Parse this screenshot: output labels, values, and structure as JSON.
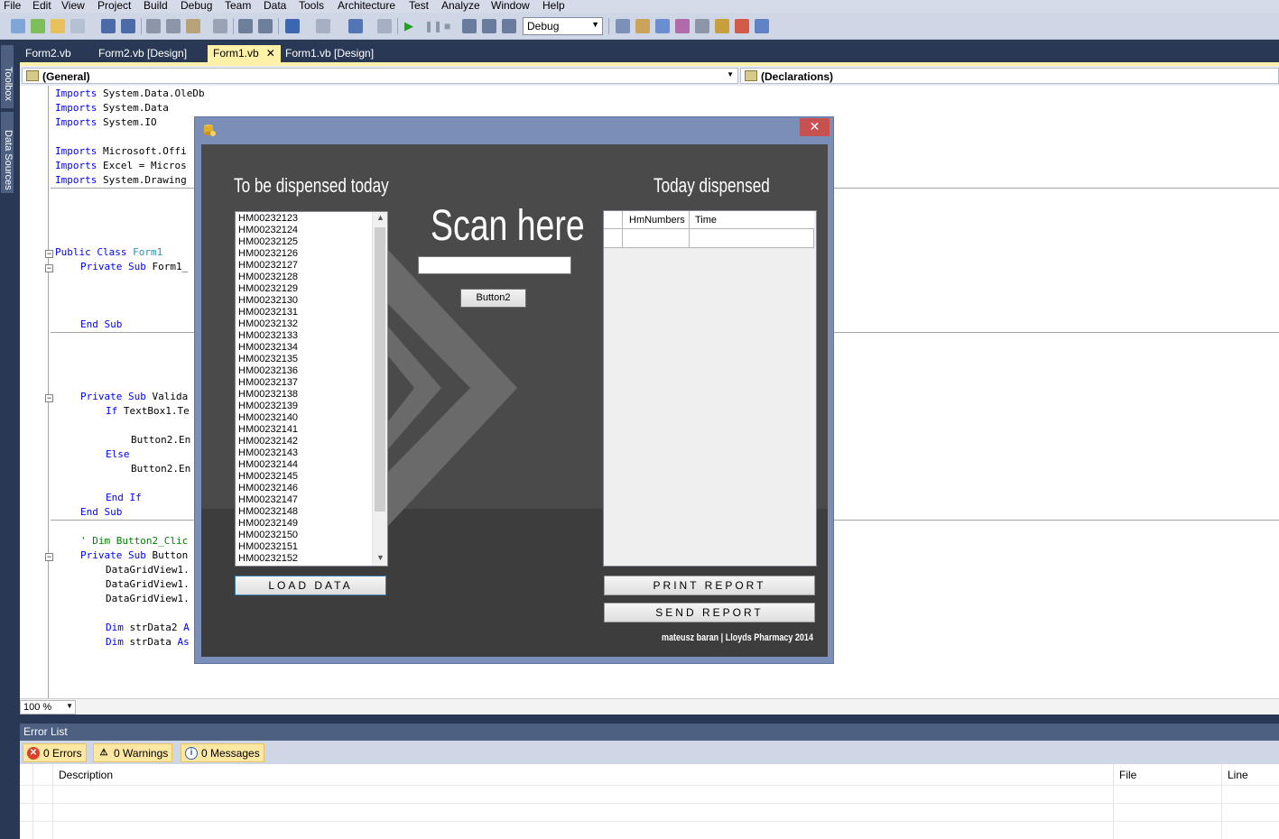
{
  "menu": [
    "File",
    "Edit",
    "View",
    "Project",
    "Build",
    "Debug",
    "Team",
    "Data",
    "Tools",
    "Architecture",
    "Test",
    "Analyze",
    "Window",
    "Help"
  ],
  "toolbar": {
    "configuration": "Debug"
  },
  "side_tabs": {
    "toolbox": "Toolbox",
    "data_sources": "Data Sources"
  },
  "doc_tabs": [
    "Form2.vb",
    "Form2.vb [Design]",
    "Form1.vb",
    "Form1.vb [Design]"
  ],
  "active_tab_close": "✕",
  "nav": {
    "left": "(General)",
    "right": "(Declarations)"
  },
  "code": {
    "l1": "Imports",
    "l1b": " System.Data.OleDb",
    "l2": "Imports",
    "l2b": " System.Data",
    "l3": "Imports",
    "l3b": " System.IO",
    "l4": "Imports",
    "l4b": " Microsoft.Offi",
    "l5": "Imports",
    "l5b": " Excel = Micros",
    "l6": "Imports",
    "l6b": " System.Drawing",
    "c1a": "Public Class",
    "c1b": "Form1",
    "c2a": "Private Sub",
    "c2b": " Form1_",
    "c3": "End Sub",
    "c4a": "Private Sub",
    "c4b": " Valida",
    "c5a": "If",
    "c5b": " TextBox1.Te",
    "c6": "Button2.En",
    "c7": "Else",
    "c8": "Button2.En",
    "c9": "End If",
    "c10": "End Sub",
    "c11": "' Dim Button2_Clic",
    "c12a": "Private Sub",
    "c12b": " Button",
    "c13": "DataGridView1.",
    "c14": "DataGridView1.",
    "c15": "DataGridView1.",
    "c16a": "Dim",
    "c16b": " strData2 ",
    "c16c": "A",
    "c17a": "Dim",
    "c17b": " strData ",
    "c17c": "As"
  },
  "zoom": "100 %",
  "error_list": {
    "title": "Error List",
    "errors": "0 Errors",
    "warnings": "0 Warnings",
    "messages": "0 Messages",
    "columns": {
      "description": "Description",
      "file": "File",
      "line": "Line"
    }
  },
  "form": {
    "close": "✕",
    "to_be_dispensed_title": "To be dispensed today",
    "today_dispensed_title": "Today dispensed",
    "scan_title": "Scan here",
    "button2": "Button2",
    "load_data": "LOAD DATA",
    "print_report": "PRINT   REPORT",
    "send_report": "SEND  REPORT",
    "credit": "mateusz baran | Lloyds Pharmacy 2014",
    "grid_columns": [
      "HmNumbers",
      "Time"
    ],
    "list_items": [
      "HM00232123",
      "HM00232124",
      "HM00232125",
      "HM00232126",
      "HM00232127",
      "HM00232128",
      "HM00232129",
      "HM00232130",
      "HM00232131",
      "HM00232132",
      "HM00232133",
      "HM00232134",
      "HM00232135",
      "HM00232136",
      "HM00232137",
      "HM00232138",
      "HM00232139",
      "HM00232140",
      "HM00232141",
      "HM00232142",
      "HM00232143",
      "HM00232144",
      "HM00232145",
      "HM00232146",
      "HM00232147",
      "HM00232148",
      "HM00232149",
      "HM00232150",
      "HM00232151",
      "HM00232152"
    ]
  }
}
